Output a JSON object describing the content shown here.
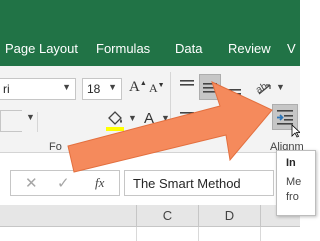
{
  "ribbon_tabs": [
    "Page Layout",
    "Formulas",
    "Data",
    "Review",
    "V"
  ],
  "font_group": {
    "font_name": "ri",
    "font_size": "18",
    "group_label": "Fo"
  },
  "alignment_group": {
    "group_label": "Alignm"
  },
  "formula_bar": {
    "fx_label": "fx",
    "content": "The Smart Method"
  },
  "columns": [
    "C",
    "D"
  ],
  "tooltip": {
    "title": "In",
    "line1": "Me",
    "line2": "fro"
  },
  "colors": {
    "ribbon_green": "#217346",
    "arrow": "#f58a5c",
    "fill_color_bar": "#ffff00",
    "font_color_bar": "#ff0000",
    "selected_button": "#c6c6c6"
  },
  "icons": [
    "cancel-icon",
    "enter-check-icon",
    "fill-color-icon",
    "font-color-icon",
    "align-top-icon",
    "align-middle-icon",
    "align-bottom-icon",
    "orientation-icon",
    "increase-indent-icon",
    "align-left-icon"
  ]
}
